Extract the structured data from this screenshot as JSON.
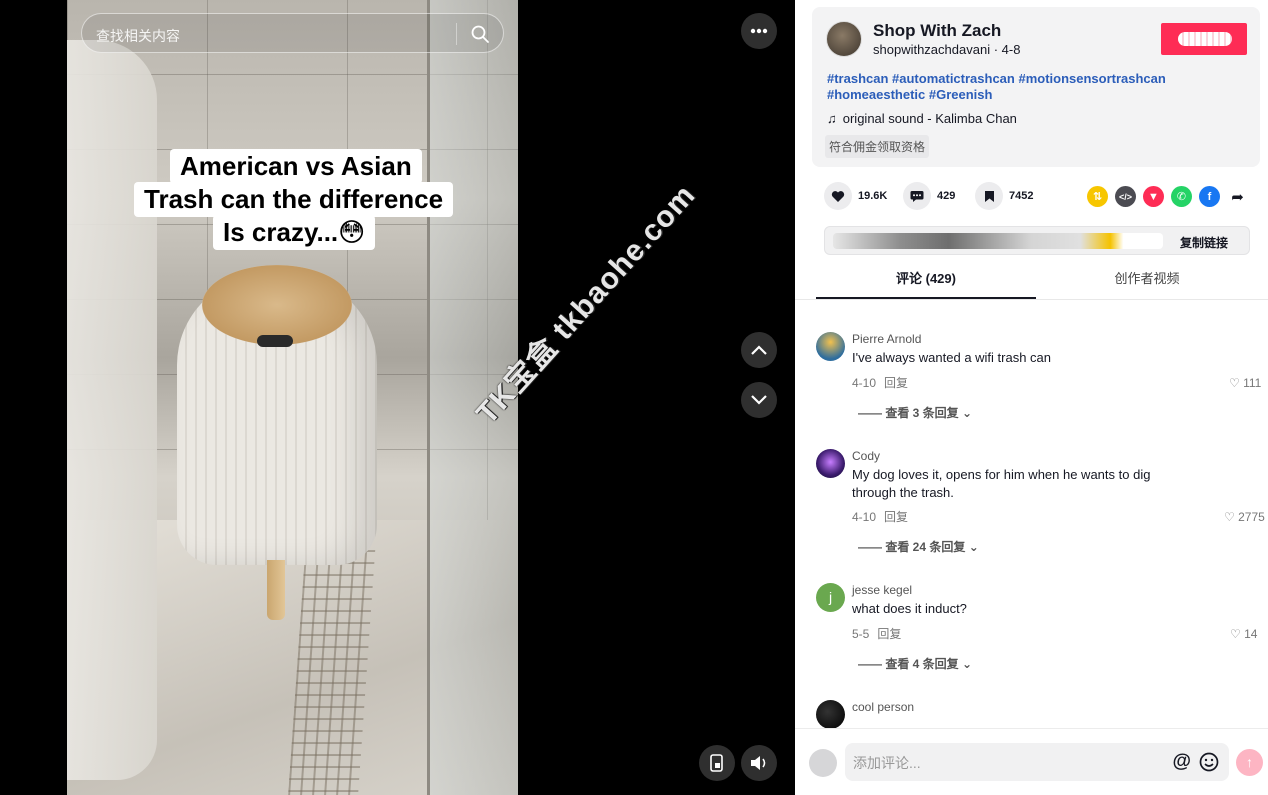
{
  "search": {
    "placeholder": "查找相关内容"
  },
  "video": {
    "caption_lines": [
      "American vs Asian",
      "Trash can the difference",
      "Is crazy...😳"
    ]
  },
  "watermark": "TK宝盒 tkbaohe.com",
  "creator": {
    "name": "Shop With Zach",
    "handle": "shopwithzachdavani · 4-8"
  },
  "description": {
    "hashtags_line1": "#trashcan #automatictrashcan #motionsensortrashcan",
    "hashtags_line2": "#homeaesthetic #Greenish",
    "music": "original sound - Kalimba Chan",
    "commission_badge": "符合佣金领取资格"
  },
  "stats": {
    "likes": "19.6K",
    "comments": "429",
    "saves": "7452"
  },
  "share_icons": [
    "repost-icon",
    "embed-icon",
    "send-to-friend-icon",
    "whatsapp-icon",
    "facebook-icon",
    "share-more-icon"
  ],
  "link_row": {
    "copy_label": "复制链接"
  },
  "tabs": [
    {
      "label": "评论 (429)"
    },
    {
      "label": "创作者视频"
    }
  ],
  "comments": [
    {
      "user": "Pierre Arnold",
      "text": "I've always wanted a wifi trash can",
      "date": "4-10",
      "reply": "回复",
      "likes": "111",
      "more": "查看 3 条回复"
    },
    {
      "user": "Cody",
      "text": "My dog loves it, opens for him when he wants to dig through the trash.",
      "date": "4-10",
      "reply": "回复",
      "likes": "2775",
      "more": "查看 24 条回复"
    },
    {
      "user": "jesse kegel",
      "text": "what does it induct?",
      "date": "5-5",
      "reply": "回复",
      "likes": "14",
      "more": "查看 4 条回复",
      "avatar_letter": "j"
    },
    {
      "user": "cool person"
    }
  ],
  "comment_input": {
    "placeholder": "添加评论...",
    "at": "@"
  },
  "colors": {
    "accent": "#fe2c55",
    "hashtag": "#2b5db9",
    "panel": "#f3f3f4"
  }
}
